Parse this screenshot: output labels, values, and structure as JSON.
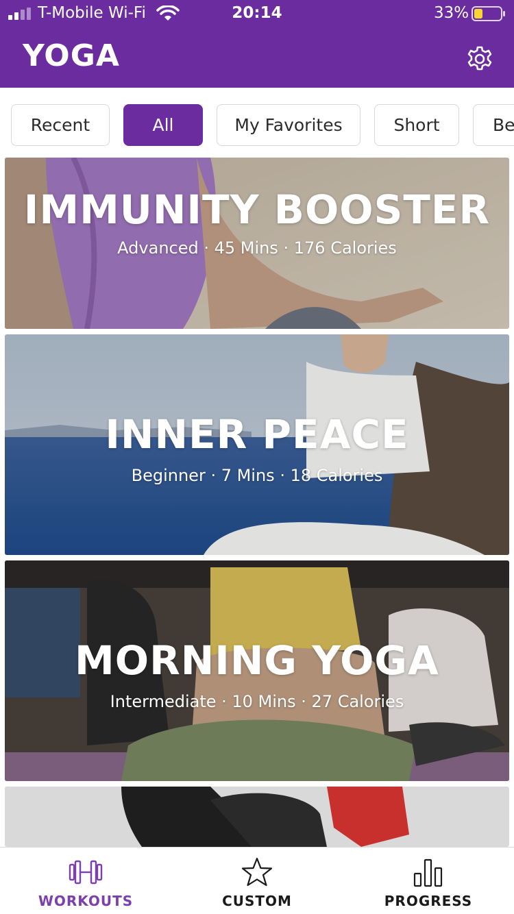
{
  "status_bar": {
    "carrier": "T-Mobile Wi-Fi",
    "time": "20:14",
    "battery": "33%"
  },
  "header": {
    "title": "YOGA",
    "settings_icon": "gear-icon"
  },
  "filters": {
    "selected": "All",
    "items": [
      "Recent",
      "All",
      "My Favorites",
      "Short",
      "Be"
    ]
  },
  "workouts": [
    {
      "title": "IMMUNITY BOOSTER",
      "subtitle": "Advanced · 45 Mins · 176 Calories"
    },
    {
      "title": "INNER PEACE",
      "subtitle": "Beginner · 7 Mins · 18 Calories"
    },
    {
      "title": "MORNING YOGA",
      "subtitle": "Intermediate · 10 Mins · 27 Calories"
    }
  ],
  "tabbar": {
    "active": "WORKOUTS",
    "items": [
      {
        "label": "WORKOUTS",
        "icon": "dumbbell-icon"
      },
      {
        "label": "CUSTOM",
        "icon": "star-icon"
      },
      {
        "label": "PROGRESS",
        "icon": "bar-chart-icon"
      }
    ]
  },
  "colors": {
    "brand": "#6b2ca0",
    "active_tab": "#7b3fae"
  }
}
